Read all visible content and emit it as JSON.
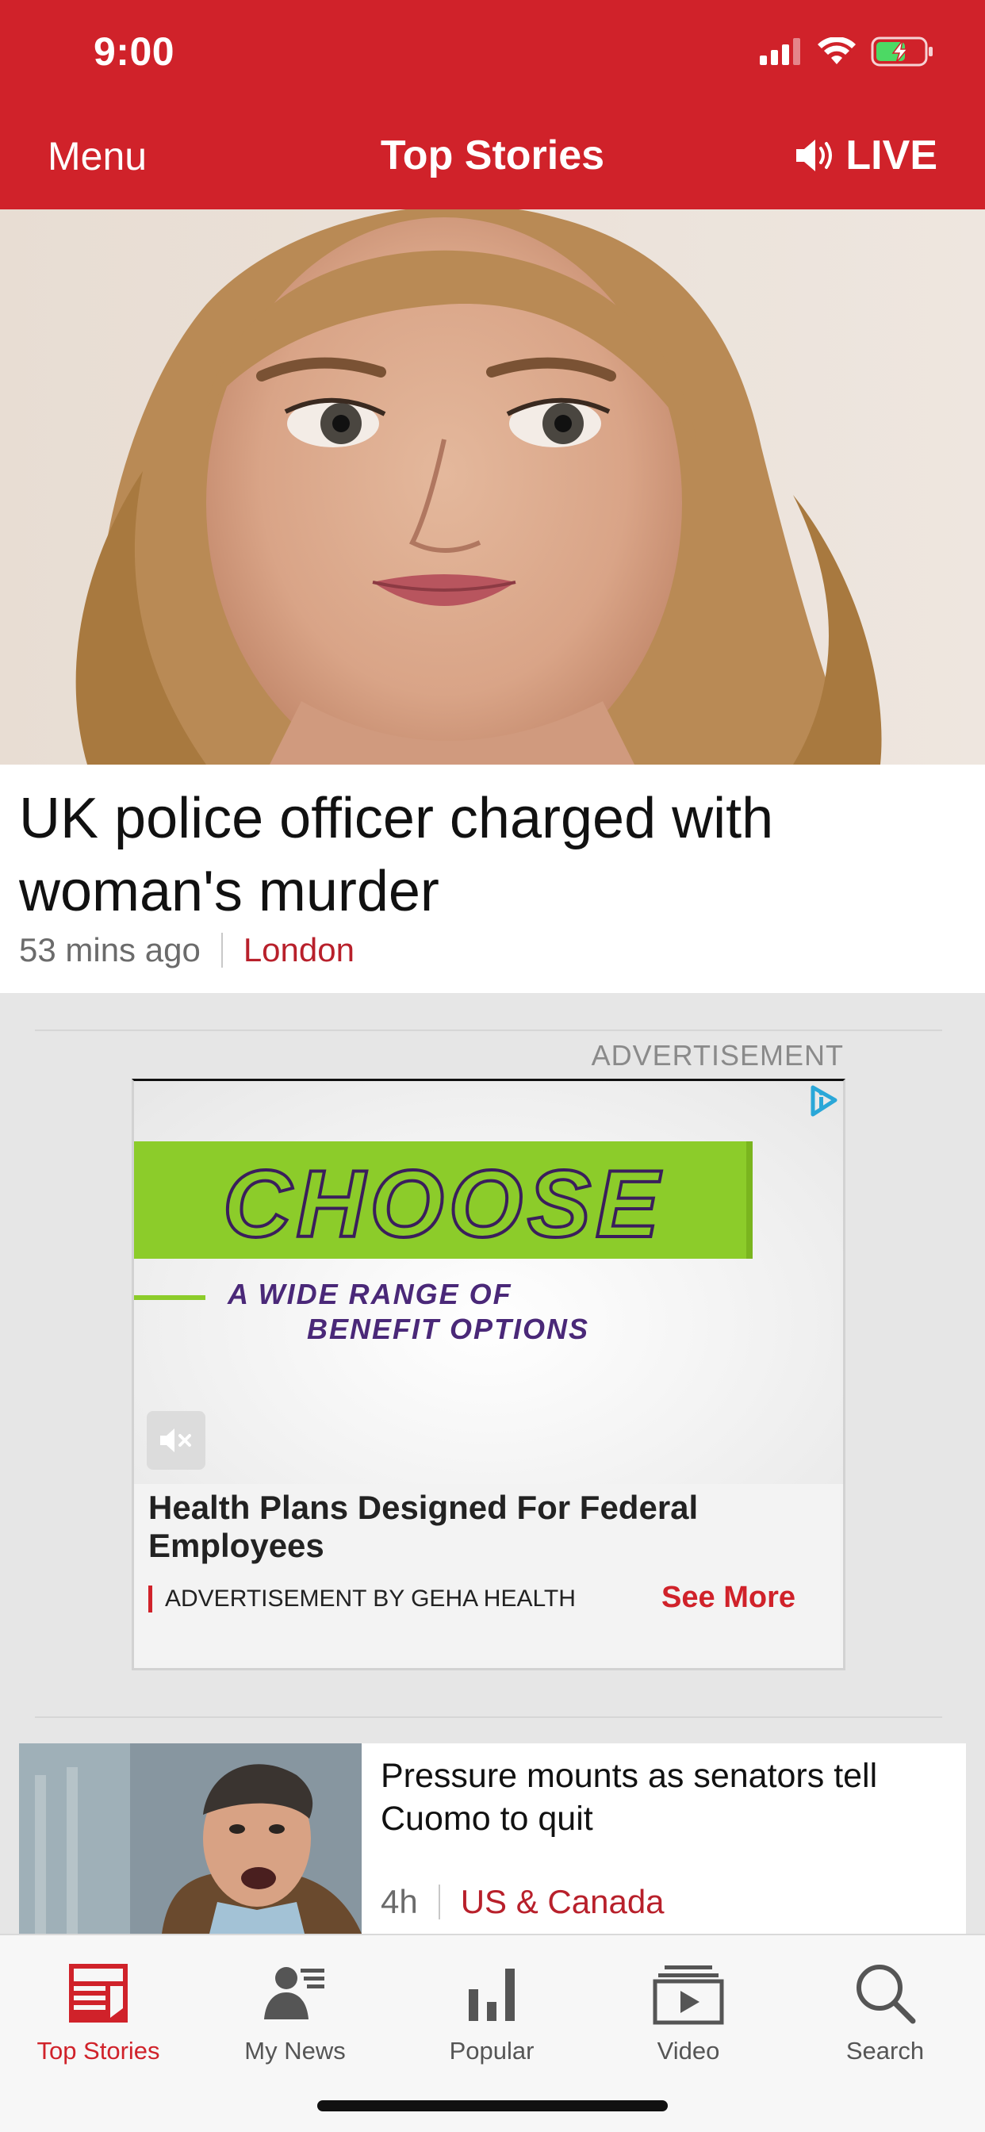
{
  "status_bar": {
    "time": "9:00"
  },
  "nav": {
    "menu": "Menu",
    "title": "Top Stories",
    "live": "LIVE"
  },
  "hero": {
    "headline": "UK police officer charged with woman's murder",
    "time": "53 mins ago",
    "topic": "London"
  },
  "ad": {
    "label": "ADVERTISEMENT",
    "banner_word": "CHOOSE",
    "banner_sub_line1": "A WIDE RANGE OF",
    "banner_sub_line2": "BENEFIT OPTIONS",
    "title": "Health Plans Designed For Federal Employees",
    "by": "ADVERTISEMENT BY GEHA HEALTH",
    "cta": "See More"
  },
  "story2": {
    "headline": "Pressure mounts as senators tell Cuomo to quit",
    "time": "4h",
    "topic": "US & Canada"
  },
  "tabs": [
    {
      "label": "Top Stories",
      "icon": "newspaper-icon",
      "active": true
    },
    {
      "label": "My News",
      "icon": "person-list-icon",
      "active": false
    },
    {
      "label": "Popular",
      "icon": "bar-chart-icon",
      "active": false
    },
    {
      "label": "Video",
      "icon": "video-icon",
      "active": false
    },
    {
      "label": "Search",
      "icon": "search-icon",
      "active": false
    }
  ],
  "colors": {
    "brand_red": "#d0222a",
    "topic_red": "#b8202b",
    "ad_green": "#8ccc2a",
    "ad_purple": "#4a2878"
  }
}
